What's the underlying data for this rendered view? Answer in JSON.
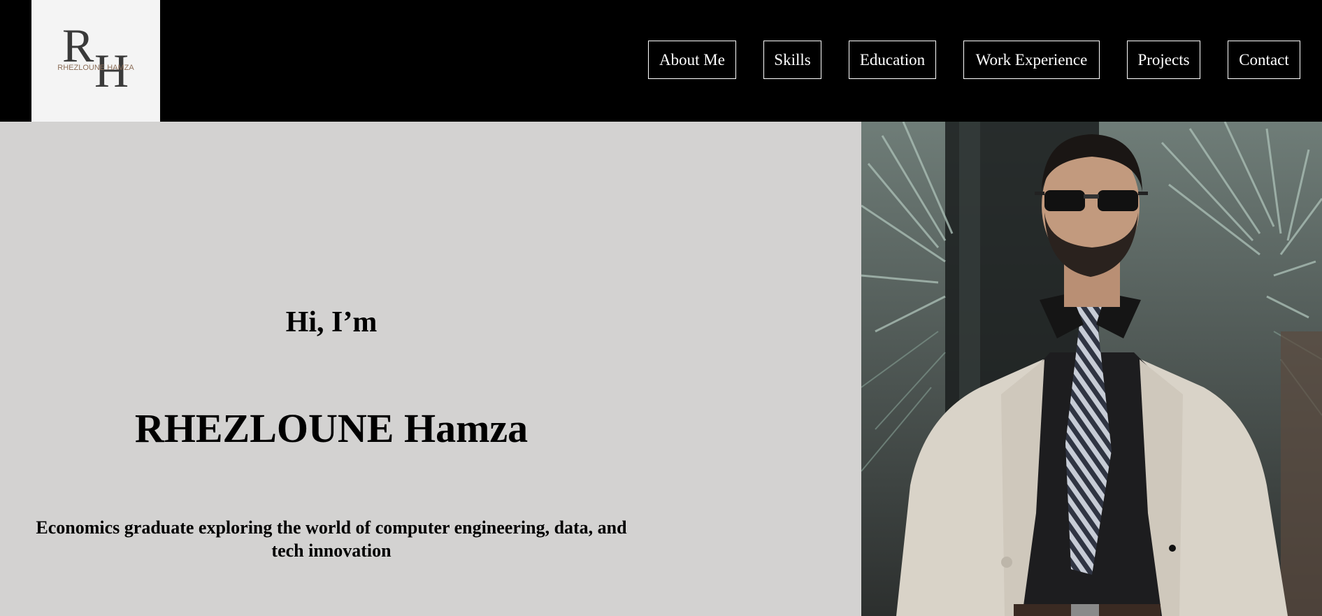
{
  "logo": {
    "monogram_r": "R",
    "monogram_h": "H",
    "wordmark": "RHEZLOUNE HAMZA"
  },
  "nav": {
    "items": [
      {
        "label": "About Me"
      },
      {
        "label": "Skills"
      },
      {
        "label": "Education"
      },
      {
        "label": "Work Experience"
      },
      {
        "label": "Projects"
      },
      {
        "label": "Contact"
      }
    ]
  },
  "hero": {
    "greeting": "Hi, I’m",
    "name": "RHEZLOUNE Hamza",
    "tagline_line1": "Economics graduate exploring the world of computer engineering, data, and",
    "tagline_line2": "tech innovation"
  },
  "colors": {
    "header_bg": "#000000",
    "logo_bg": "#f4f4f4",
    "hero_bg": "#d3d2d1",
    "text": "#000000",
    "nav_text": "#ffffff"
  }
}
